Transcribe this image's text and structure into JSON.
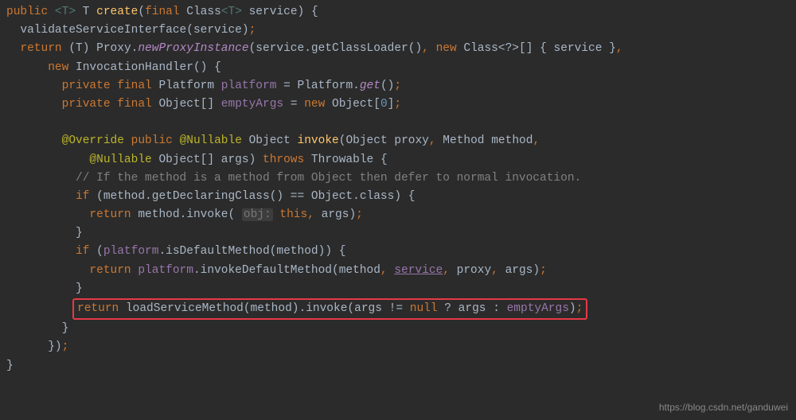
{
  "chart_data": null,
  "watermark": "https://blog.csdn.net/ganduwei",
  "tokens": {
    "public": "public",
    "lt": "<",
    "gt": ">",
    "T": "T",
    "create": "create",
    "lparen": "(",
    "final": "final",
    "Class": "Class",
    "service": "service",
    "rparen": ")",
    "lbrace": "{",
    "rbrace": "}",
    "validateServiceInterface": "validateServiceInterface",
    "semi": ";",
    "return": "return",
    "Proxy": "Proxy",
    "newProxyInstance": "newProxyInstance",
    "getClassLoader": "getClassLoader",
    "comma": ",",
    "new": "new",
    "Class_q": "Class<?>[]",
    "InvocationHandler": "InvocationHandler",
    "private": "private",
    "Platform": "Platform",
    "platform": "platform",
    "eq": "=",
    "get": "get",
    "Object": "Object",
    "brackets": "[]",
    "emptyArgs": "emptyArgs",
    "zero": "0",
    "Override": "@Override",
    "Nullable": "@Nullable",
    "invoke": "invoke",
    "proxy": "proxy",
    "Method": "Method",
    "method": "method",
    "args": "args",
    "throws": "throws",
    "Throwable": "Throwable",
    "comment1": "// If the method is a method from Object then defer to normal invocation.",
    "if": "if",
    "getDeclaringClass": "getDeclaringClass",
    "eqeq": "==",
    "dotclass": ".class",
    "obj_hint": "obj:",
    "this": "this",
    "isDefaultMethod": "isDefaultMethod",
    "invokeDefaultMethod": "invokeDefaultMethod",
    "loadServiceMethod": "loadServiceMethod",
    "neq": "!=",
    "null": "null",
    "qmark": "?",
    "colon": ":",
    "dot": "."
  }
}
